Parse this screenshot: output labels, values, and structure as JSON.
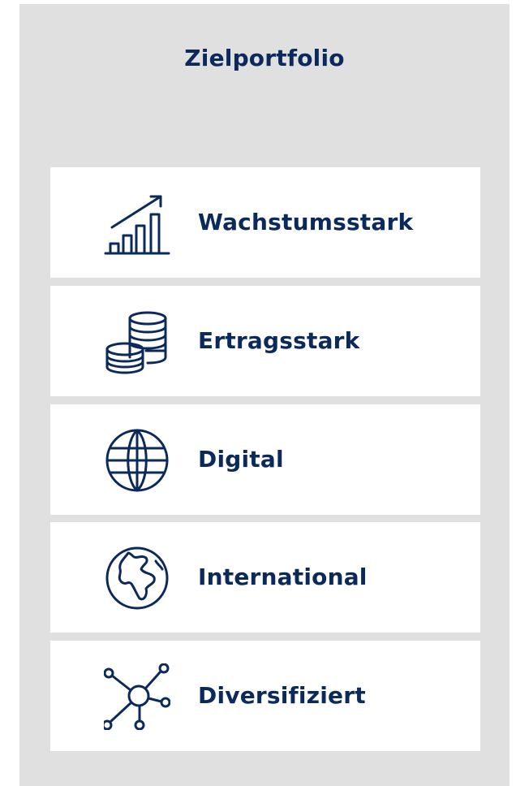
{
  "colors": {
    "accent": "#0b2a5b",
    "background": "#e0e0e0",
    "card": "#ffffff"
  },
  "title": "Zielportfolio",
  "items": [
    {
      "label": "Wachstumsstark",
      "icon": "growth-chart-icon"
    },
    {
      "label": "Ertragsstark",
      "icon": "coin-stack-icon"
    },
    {
      "label": "Digital",
      "icon": "globe-grid-icon"
    },
    {
      "label": "International",
      "icon": "earth-continents-icon"
    },
    {
      "label": "Diversifiziert",
      "icon": "network-hub-icon"
    }
  ]
}
